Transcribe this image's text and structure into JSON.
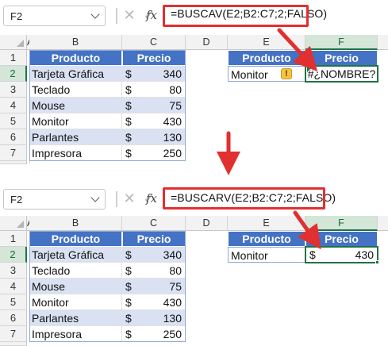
{
  "top": {
    "name_box": "F2",
    "formula": "=BUSCAV(E2;B2:C7;2;FALSO)",
    "fx_label": "fx",
    "column_headers": [
      "A",
      "B",
      "C",
      "D",
      "E",
      "F"
    ],
    "row_headers": [
      "1",
      "2",
      "3",
      "4",
      "5",
      "6",
      "7"
    ],
    "table": {
      "header": [
        "Producto",
        "Precio"
      ],
      "rows": [
        {
          "product": "Tarjeta Gráfica",
          "currency": "$",
          "price": "340"
        },
        {
          "product": "Teclado",
          "currency": "$",
          "price": "80"
        },
        {
          "product": "Mouse",
          "currency": "$",
          "price": "75"
        },
        {
          "product": "Monitor",
          "currency": "$",
          "price": "430"
        },
        {
          "product": "Parlantes",
          "currency": "$",
          "price": "130"
        },
        {
          "product": "Impresora",
          "currency": "$",
          "price": "250"
        }
      ]
    },
    "lookup": {
      "header": [
        "Producto",
        "Precio"
      ],
      "product": "Monitor",
      "warning_glyph": "!",
      "result": "#¿NOMBRE?"
    }
  },
  "bottom": {
    "name_box": "F2",
    "formula": "=BUSCARV(E2;B2:C7;2;FALSO)",
    "fx_label": "fx",
    "column_headers": [
      "A",
      "B",
      "C",
      "D",
      "E",
      "F"
    ],
    "row_headers": [
      "1",
      "2",
      "3",
      "4",
      "5",
      "6",
      "7"
    ],
    "table": {
      "header": [
        "Producto",
        "Precio"
      ],
      "rows": [
        {
          "product": "Tarjeta Gráfica",
          "currency": "$",
          "price": "340"
        },
        {
          "product": "Teclado",
          "currency": "$",
          "price": "80"
        },
        {
          "product": "Mouse",
          "currency": "$",
          "price": "75"
        },
        {
          "product": "Monitor",
          "currency": "$",
          "price": "430"
        },
        {
          "product": "Parlantes",
          "currency": "$",
          "price": "130"
        },
        {
          "product": "Impresora",
          "currency": "$",
          "price": "250"
        }
      ]
    },
    "lookup": {
      "header": [
        "Producto",
        "Precio"
      ],
      "product": "Monitor",
      "result_currency": "$",
      "result": "430"
    }
  },
  "icons": {
    "cancel": "close-icon",
    "enter": "check-icon",
    "function": "fx-icon",
    "annotation": "red-arrow-icon",
    "warning": "warning-icon"
  },
  "colors": {
    "table_header": "#4472c4",
    "band": "#d9e1f2",
    "selection": "#217346",
    "annotation": "#e03030"
  }
}
